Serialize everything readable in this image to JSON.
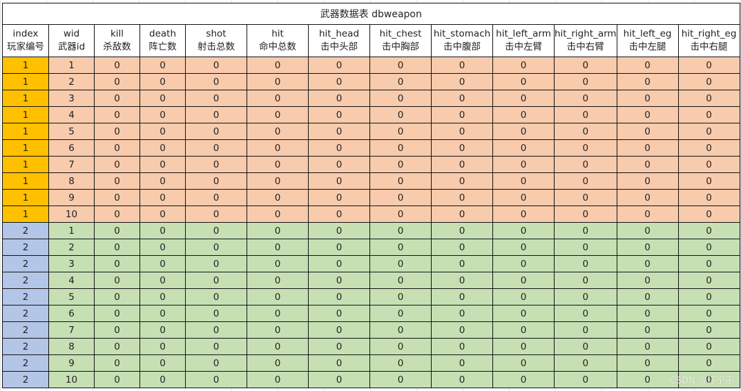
{
  "title": "武器数据表 dbweapon",
  "columns": [
    {
      "en": "index",
      "zh": "玩家编号"
    },
    {
      "en": "wid",
      "zh": "武器id"
    },
    {
      "en": "kill",
      "zh": "杀敌数"
    },
    {
      "en": "death",
      "zh": "阵亡数"
    },
    {
      "en": "shot",
      "zh": "射击总数"
    },
    {
      "en": "hit",
      "zh": "命中总数"
    },
    {
      "en": "hit_head",
      "zh": "击中头部"
    },
    {
      "en": "hit_chest",
      "zh": "击中胸部"
    },
    {
      "en": "hit_stomach",
      "zh": "击中腹部"
    },
    {
      "en": "hit_left_arm",
      "zh": "击中左臂"
    },
    {
      "en": "hit_right_arm",
      "zh": "击中右臂"
    },
    {
      "en": "hit_left_eg",
      "zh": "击中左腿"
    },
    {
      "en": "hit_right_eg",
      "zh": "击中右腿"
    }
  ],
  "rows": [
    [
      "1",
      "1",
      "0",
      "0",
      "0",
      "0",
      "0",
      "0",
      "0",
      "0",
      "0",
      "0",
      "0"
    ],
    [
      "1",
      "2",
      "0",
      "0",
      "0",
      "0",
      "0",
      "0",
      "0",
      "0",
      "0",
      "0",
      "0"
    ],
    [
      "1",
      "3",
      "0",
      "0",
      "0",
      "0",
      "0",
      "0",
      "0",
      "0",
      "0",
      "0",
      "0"
    ],
    [
      "1",
      "4",
      "0",
      "0",
      "0",
      "0",
      "0",
      "0",
      "0",
      "0",
      "0",
      "0",
      "0"
    ],
    [
      "1",
      "5",
      "0",
      "0",
      "0",
      "0",
      "0",
      "0",
      "0",
      "0",
      "0",
      "0",
      "0"
    ],
    [
      "1",
      "6",
      "0",
      "0",
      "0",
      "0",
      "0",
      "0",
      "0",
      "0",
      "0",
      "0",
      "0"
    ],
    [
      "1",
      "7",
      "0",
      "0",
      "0",
      "0",
      "0",
      "0",
      "0",
      "0",
      "0",
      "0",
      "0"
    ],
    [
      "1",
      "8",
      "0",
      "0",
      "0",
      "0",
      "0",
      "0",
      "0",
      "0",
      "0",
      "0",
      "0"
    ],
    [
      "1",
      "9",
      "0",
      "0",
      "0",
      "0",
      "0",
      "0",
      "0",
      "0",
      "0",
      "0",
      "0"
    ],
    [
      "1",
      "10",
      "0",
      "0",
      "0",
      "0",
      "0",
      "0",
      "0",
      "0",
      "0",
      "0",
      "0"
    ],
    [
      "2",
      "1",
      "0",
      "0",
      "0",
      "0",
      "0",
      "0",
      "0",
      "0",
      "0",
      "0",
      "0"
    ],
    [
      "2",
      "2",
      "0",
      "0",
      "0",
      "0",
      "0",
      "0",
      "0",
      "0",
      "0",
      "0",
      "0"
    ],
    [
      "2",
      "3",
      "0",
      "0",
      "0",
      "0",
      "0",
      "0",
      "0",
      "0",
      "0",
      "0",
      "0"
    ],
    [
      "2",
      "4",
      "0",
      "0",
      "0",
      "0",
      "0",
      "0",
      "0",
      "0",
      "0",
      "0",
      "0"
    ],
    [
      "2",
      "5",
      "0",
      "0",
      "0",
      "0",
      "0",
      "0",
      "0",
      "0",
      "0",
      "0",
      "0"
    ],
    [
      "2",
      "6",
      "0",
      "0",
      "0",
      "0",
      "0",
      "0",
      "0",
      "0",
      "0",
      "0",
      "0"
    ],
    [
      "2",
      "7",
      "0",
      "0",
      "0",
      "0",
      "0",
      "0",
      "0",
      "0",
      "0",
      "0",
      "0"
    ],
    [
      "2",
      "8",
      "0",
      "0",
      "0",
      "0",
      "0",
      "0",
      "0",
      "0",
      "0",
      "0",
      "0"
    ],
    [
      "2",
      "9",
      "0",
      "0",
      "0",
      "0",
      "0",
      "0",
      "0",
      "0",
      "0",
      "0",
      "0"
    ],
    [
      "2",
      "10",
      "0",
      "0",
      "0",
      "0",
      "0",
      "0",
      "0",
      "0",
      "0",
      "0",
      "0"
    ]
  ],
  "group_colors": {
    "player1_index": "#ffc000",
    "player1_cells": "#f8cbad",
    "player2_index": "#b4c6e7",
    "player2_cells": "#c6e0b4"
  },
  "watermark": "CSDN @汪宁宇"
}
